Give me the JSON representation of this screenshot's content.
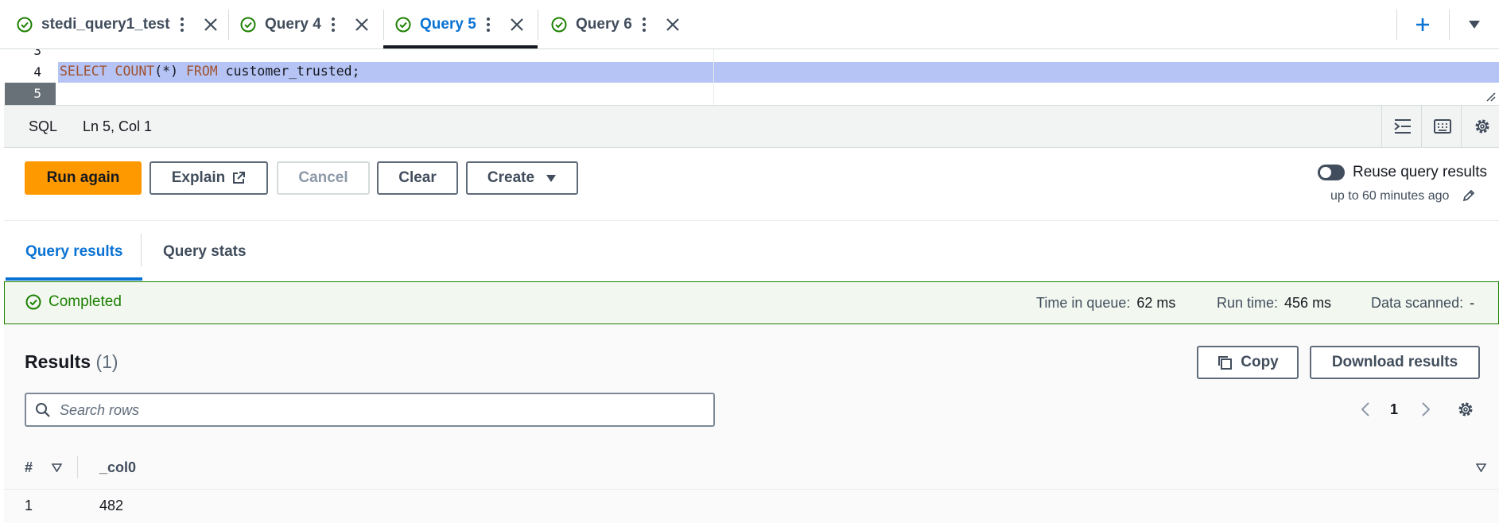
{
  "tabs": [
    {
      "label": "stedi_query1_test",
      "status": "completed",
      "active": false
    },
    {
      "label": "Query 4",
      "status": "completed",
      "active": false
    },
    {
      "label": "Query 5",
      "status": "completed",
      "active": true
    },
    {
      "label": "Query 6",
      "status": "completed",
      "active": false
    }
  ],
  "editor": {
    "line_numbers": [
      "3",
      "4",
      "5"
    ],
    "code_tokens": [
      "SELECT",
      "COUNT",
      "(*)",
      "FROM",
      "customer_trusted;"
    ]
  },
  "statusbar": {
    "language": "SQL",
    "cursor": "Ln 5, Col 1"
  },
  "actions": {
    "run_again": "Run again",
    "explain": "Explain",
    "cancel": "Cancel",
    "clear": "Clear",
    "create": "Create",
    "reuse_label": "Reuse query results",
    "reuse_sub": "up to 60 minutes ago",
    "reuse_enabled": false
  },
  "result_tabs": [
    {
      "label": "Query results",
      "active": true
    },
    {
      "label": "Query stats",
      "active": false
    }
  ],
  "banner": {
    "status": "Completed",
    "time_in_queue_label": "Time in queue:",
    "time_in_queue": "62 ms",
    "run_time_label": "Run time:",
    "run_time": "456 ms",
    "data_scanned_label": "Data scanned:",
    "data_scanned": "-"
  },
  "results": {
    "title": "Results",
    "count": "(1)",
    "copy_label": "Copy",
    "download_label": "Download results",
    "search_placeholder": "Search rows",
    "page": "1",
    "columns": [
      "#",
      "_col0"
    ],
    "rows": [
      [
        "1",
        "482"
      ]
    ]
  },
  "colors": {
    "accent": "#0972d3",
    "success": "#1d8102",
    "primary_button": "#ff9900",
    "selection": "#b5c3f5"
  }
}
